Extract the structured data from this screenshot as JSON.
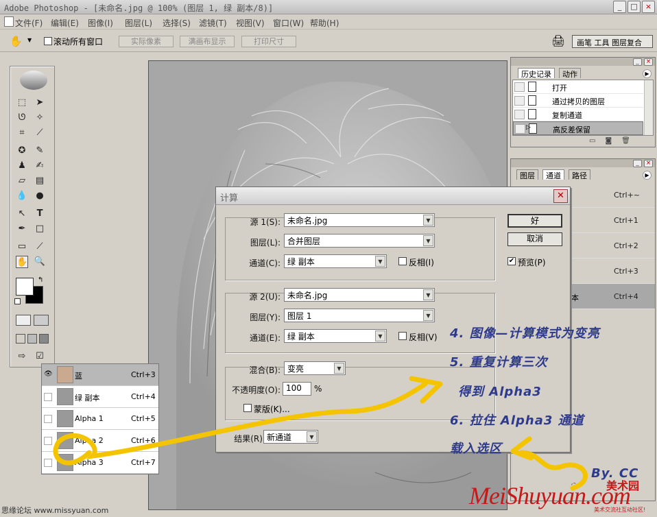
{
  "window": {
    "title": "Adobe Photoshop - [未命名.jpg @ 100% (图层 1, 绿 副本/8)]"
  },
  "menu": [
    "文件(F)",
    "编辑(E)",
    "图像(I)",
    "图层(L)",
    "选择(S)",
    "滤镜(T)",
    "视图(V)",
    "窗口(W)",
    "帮助(H)"
  ],
  "options": {
    "scroll_all": "滚动所有窗口",
    "actual_pixels": "实际像素",
    "fit_screen": "满画布显示",
    "print_size": "打印尺寸",
    "palette_well": "画笔 工具 图层复合"
  },
  "history": {
    "tabs": [
      "历史记录",
      "动作"
    ],
    "items": [
      "打开",
      "通过拷贝的图层",
      "复制通道",
      "高反差保留"
    ]
  },
  "channels": {
    "tabs": [
      "图层",
      "通道",
      "路径"
    ],
    "rows": [
      {
        "name": "",
        "shortcut": "Ctrl+~"
      },
      {
        "name": "",
        "shortcut": "Ctrl+1"
      },
      {
        "name": "",
        "shortcut": "Ctrl+2"
      },
      {
        "name": "",
        "shortcut": "Ctrl+3"
      },
      {
        "name": "本",
        "shortcut": "Ctrl+4"
      }
    ]
  },
  "float_channels": [
    {
      "name": "蓝",
      "shortcut": "Ctrl+3"
    },
    {
      "name": "绿 副本",
      "shortcut": "Ctrl+4"
    },
    {
      "name": "Alpha 1",
      "shortcut": "Ctrl+5"
    },
    {
      "name": "Alpha 2",
      "shortcut": "Ctrl+6"
    },
    {
      "name": "Alpha 3",
      "shortcut": "Ctrl+7"
    }
  ],
  "dialog": {
    "title": "计算",
    "source1": {
      "label": "源 1(S):",
      "value": "未命名.jpg",
      "layer_label": "图层(L):",
      "layer": "合并图层",
      "channel_label": "通道(C):",
      "channel": "绿 副本",
      "invert": "反相(I)"
    },
    "source2": {
      "label": "源 2(U):",
      "value": "未命名.jpg",
      "layer_label": "图层(Y):",
      "layer": "图层 1",
      "channel_label": "通道(E):",
      "channel": "绿 副本",
      "invert": "反相(V)"
    },
    "blend": {
      "label": "混合(B):",
      "value": "变亮",
      "opacity_label": "不透明度(O):",
      "opacity": "100",
      "unit": "%",
      "mask": "蒙版(K)..."
    },
    "result": {
      "label": "结果(R):",
      "value": "新通道"
    },
    "ok": "好",
    "cancel": "取消",
    "preview": "预览(P)"
  },
  "notes": [
    "4. 图像—计算模式为变亮",
    "5. 重复计算三次",
    "得到 Alpha3",
    "6. 拉住 Alpha3 通道",
    "载入选区"
  ],
  "credit": "By. CC",
  "watermark": {
    "main": "MeiShuyuan.com",
    "brand": "美术园",
    "sub": "美术交流社互动社区!",
    "left": "思缘论坛 www.missyuan.com"
  }
}
